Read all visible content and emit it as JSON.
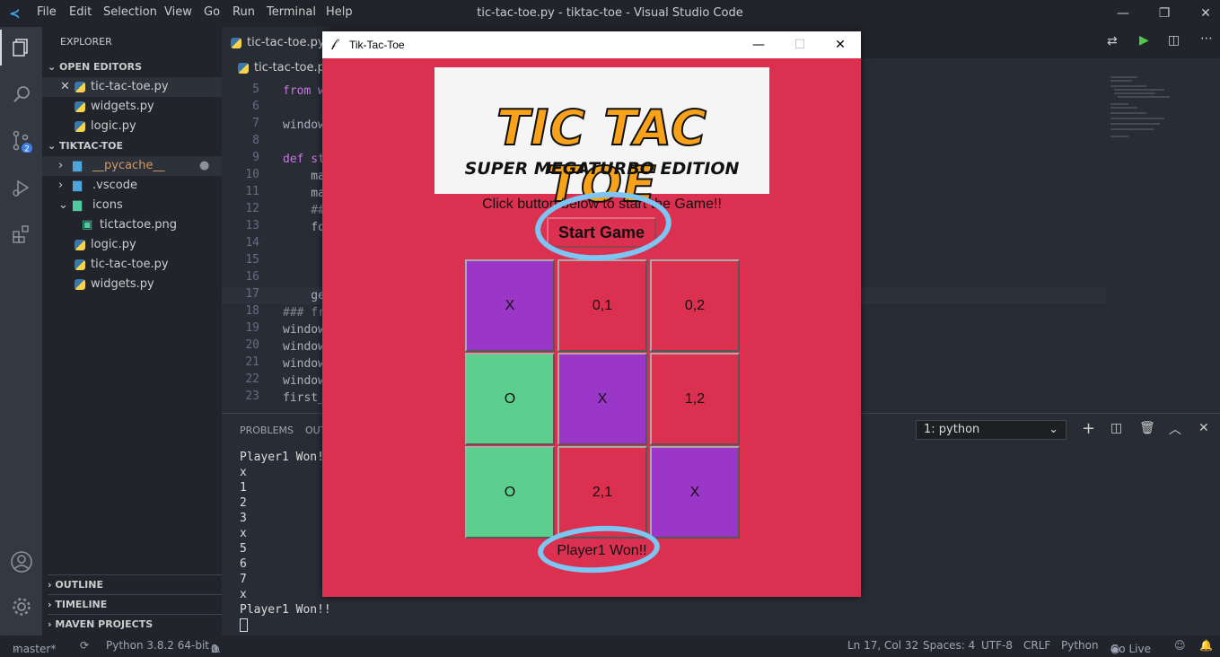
{
  "titlebar": {
    "menus": [
      "File",
      "Edit",
      "Selection",
      "View",
      "Go",
      "Run",
      "Terminal",
      "Help"
    ],
    "title": "tic-tac-toe.py - tiktac-toe - Visual Studio Code"
  },
  "sidebar": {
    "header": "EXPLORER",
    "open_editors_label": "OPEN EDITORS",
    "open_editors": [
      "tic-tac-toe.py",
      "widgets.py",
      "logic.py"
    ],
    "project_label": "TIKTAC-TOE",
    "tree": {
      "pycache": "__pycache__",
      "vscode": ".vscode",
      "icons": "icons",
      "png": "tictactoe.png",
      "logic": "logic.py",
      "main": "tic-tac-toe.py",
      "widgets": "widgets.py"
    },
    "outline": "OUTLINE",
    "timeline": "TIMELINE",
    "maven": "MAVEN PROJECTS"
  },
  "editor": {
    "tab_active": "tic-tac-toe.py",
    "breadcrumb": "tic-tac-toe.py",
    "lines": [
      {
        "n": "5",
        "text": "from w"
      },
      {
        "n": "6",
        "text": ""
      },
      {
        "n": "7",
        "text": "window"
      },
      {
        "n": "8",
        "text": ""
      },
      {
        "n": "9",
        "text": "def st"
      },
      {
        "n": "10",
        "text": "    ma"
      },
      {
        "n": "11",
        "text": "    ma"
      },
      {
        "n": "12",
        "text": "    ##"
      },
      {
        "n": "13",
        "text": "    fo"
      },
      {
        "n": "14",
        "text": ""
      },
      {
        "n": "15",
        "text": ""
      },
      {
        "n": "16",
        "text": ""
      },
      {
        "n": "17",
        "text": "    ge"
      },
      {
        "n": "18",
        "text": "### fr"
      },
      {
        "n": "19",
        "text": "window"
      },
      {
        "n": "20",
        "text": "window"
      },
      {
        "n": "21",
        "text": "window"
      },
      {
        "n": "22",
        "text": "window"
      },
      {
        "n": "23",
        "text": "first_"
      }
    ]
  },
  "panel": {
    "tabs": [
      "PROBLEMS",
      "OUT"
    ],
    "terminal_select": "1: python",
    "output": [
      "Player1 Won!!",
      "x",
      "1",
      "2",
      "3",
      "x",
      "5",
      "6",
      "7",
      "x",
      "Player1 Won!!"
    ]
  },
  "status": {
    "branch": "master*",
    "python": "Python 3.8.2 64-bit",
    "errors": "0",
    "warnings": "0",
    "position": "Ln 17, Col 32",
    "spaces": "Spaces: 4",
    "encoding": "UTF-8",
    "eol": "CRLF",
    "language": "Python",
    "golive": "Go Live"
  },
  "tk": {
    "title": "Tik-Tac-Toe",
    "banner_main": "TIC TAC TOE",
    "banner_sub": "SUPER MEGATURBO EDITION",
    "instruction": "Click button below to start the Game!!",
    "start_label": "Start Game",
    "result": "Player1 Won!!",
    "cells": [
      {
        "label": "X",
        "color": "#9a37c9"
      },
      {
        "label": "0,1",
        "color": "#dc3050"
      },
      {
        "label": "0,2",
        "color": "#dc3050"
      },
      {
        "label": "O",
        "color": "#5ccf8f"
      },
      {
        "label": "X",
        "color": "#9a37c9"
      },
      {
        "label": "1,2",
        "color": "#dc3050"
      },
      {
        "label": "O",
        "color": "#5ccf8f"
      },
      {
        "label": "2,1",
        "color": "#dc3050"
      },
      {
        "label": "X",
        "color": "#9a37c9"
      }
    ]
  },
  "colors": {
    "accent_ring": "#7dc5f2",
    "x_cell": "#9a37c9",
    "o_cell": "#5ccf8f",
    "empty_cell": "#dc3050"
  }
}
